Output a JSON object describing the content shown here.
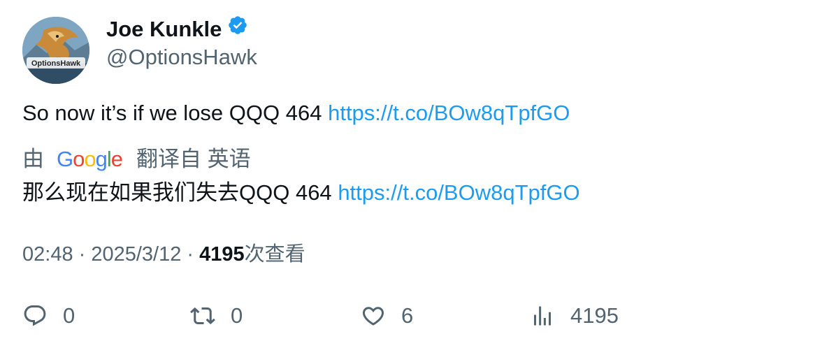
{
  "author": {
    "name": "Joe Kunkle",
    "handle": "@OptionsHawk",
    "avatar_text": "OptionsHawk",
    "verified_color": "#1d9bf0"
  },
  "tweet": {
    "text": "So now it’s if we lose QQQ 464",
    "link": "https://t.co/BOw8qTpfGO"
  },
  "translation": {
    "prefix": "由",
    "provider_letters": [
      "G",
      "o",
      "o",
      "g",
      "l",
      "e"
    ],
    "provider_colors": [
      "#4285F4",
      "#EA4335",
      "#FBBC05",
      "#4285F4",
      "#34A853",
      "#EA4335"
    ],
    "suffix": "翻译自 英语",
    "text": "那么现在如果我们失去QQQ 464",
    "link": "https://t.co/BOw8qTpfGO"
  },
  "meta": {
    "time": "02:48",
    "separator": " · ",
    "date": "2025/3/12",
    "views_count": "4195",
    "views_label": "次查看"
  },
  "actions": {
    "reply": {
      "icon": "reply-icon",
      "count": "0"
    },
    "retweet": {
      "icon": "retweet-icon",
      "count": "0"
    },
    "like": {
      "icon": "heart-icon",
      "count": "6"
    },
    "views": {
      "icon": "views-icon",
      "count": "4195"
    }
  },
  "colors": {
    "text": "#0f1419",
    "secondary": "#536471",
    "link": "#1d9bf0"
  }
}
